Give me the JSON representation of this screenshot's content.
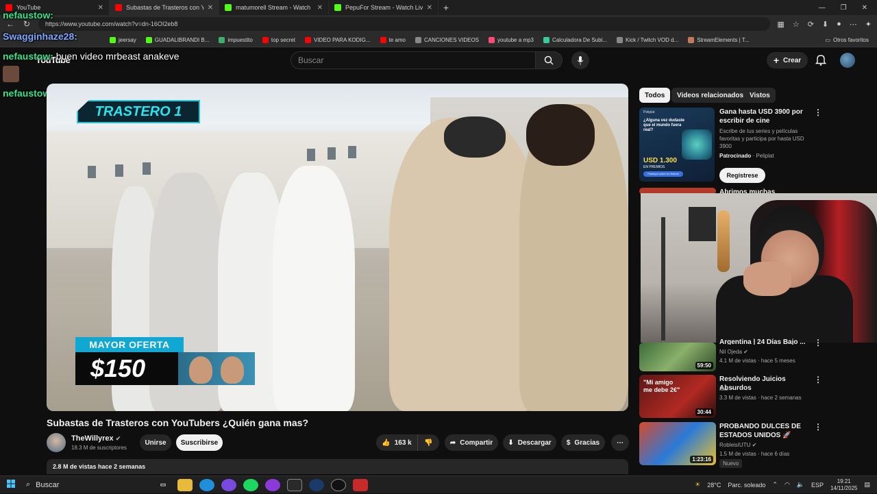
{
  "browser": {
    "tabs": [
      {
        "label": "YouTube",
        "color": "#ff0000",
        "active": false
      },
      {
        "label": "Subastas de Trasteros con Yo",
        "color": "#ff0000",
        "active": true
      },
      {
        "label": "matumorell Stream - Watch",
        "color": "#53fc18",
        "active": false
      },
      {
        "label": "PepuFor Stream - Watch Live",
        "color": "#53fc18",
        "active": false
      }
    ],
    "url": "https://www.youtube.com/watch?v=dn-16OI2eb8",
    "bookmarks": [
      {
        "label": "jeersay",
        "color": "#53fc18"
      },
      {
        "label": "GUADALIBRANDI B...",
        "color": "#53fc18"
      },
      {
        "label": "impuestito",
        "color": "#3fae6a"
      },
      {
        "label": "top secret",
        "color": "#ff0000"
      },
      {
        "label": "VIDEO PARA KODIG...",
        "color": "#ff0000"
      },
      {
        "label": "te amo",
        "color": "#ff0000"
      },
      {
        "label": "CANCIONES VIDEOS",
        "color": "#888888"
      },
      {
        "label": "youtube a mp3",
        "color": "#ff4a7a"
      },
      {
        "label": "Calculadora De Subi...",
        "color": "#39c8a0"
      },
      {
        "label": "Kick / Twitch VOD d...",
        "color": "#888888"
      },
      {
        "label": "StreamElements | T...",
        "color": "#c27a5a"
      }
    ],
    "other_bookmarks": "Otros favoritos"
  },
  "chat": [
    {
      "user": "nefaustow:",
      "message": ""
    },
    {
      "user": "Swagginhaze28:",
      "message": ""
    },
    {
      "user": "nefaustow:",
      "message": "buen video mrbeast anakeve"
    },
    {
      "user": "nefaustow:",
      "message": ""
    }
  ],
  "header": {
    "logo": "YouTube",
    "search_placeholder": "Buscar",
    "create_label": "Crear"
  },
  "video": {
    "overlay_label": "TRASTERO 1",
    "offer_label": "MAYOR OFERTA",
    "offer_value": "$150",
    "title": "Subastas de Trasteros con YouTubers ¿Quién gana mas?",
    "channel": "TheWillyrex",
    "subscribers": "18.3 M de suscriptores",
    "join_label": "Unirse",
    "subscribe_label": "Suscribirse",
    "likes": "163 k",
    "share_label": "Compartir",
    "download_label": "Descargar",
    "thanks_label": "Gracias",
    "views_line": "2.8 M de vistas  hace 2 semanas"
  },
  "sidebar": {
    "chips": [
      "Todos",
      "Videos relacionados",
      "Vistos"
    ],
    "ad": {
      "title": "Gana hasta USD 3900 por escribir de cine",
      "description": "Escribe de tus series y películas favoritas y participa por hasta USD 3900",
      "sponsored": "Patrocinado",
      "advertiser": "Peliplat",
      "cta": "Regístrese",
      "thumb_brand": "Peliplat",
      "thumb_question": "¿Alguna vez dudaste que el mundo fuera real?",
      "thumb_prize": "USD 1.300",
      "thumb_prize_note": "EN PREMIOS",
      "thumb_button": "Participa sobre la Historia"
    },
    "partial_title": "Abrimos muchas MYSTERY",
    "videos": [
      {
        "title": "Argentina | 24 Días Bajo ...",
        "channel": "Nil Ojeda",
        "meta": "4.1 M de vistas · hace 5 meses",
        "duration": "59:50",
        "thumb_text": ""
      },
      {
        "title": "Resolviendo Juicios Absurdos",
        "channel": "Ibai",
        "meta": "3.3 M de vistas · hace 2 semanas",
        "duration": "30:44",
        "thumb_text": "\"Mi amigo me debe 2€\""
      },
      {
        "title": "PROBANDO DULCES DE ESTADOS UNIDOS 🚀",
        "channel": "RobleisIUTU",
        "meta": "1.5 M de vistas · hace 6 días",
        "duration": "1:23:16",
        "thumb_text": "",
        "badge": "Nuevo"
      }
    ]
  },
  "taskbar": {
    "search": "Buscar",
    "temperature": "28°C",
    "weather": "Parc. soleado",
    "language": "ESP",
    "time": "19:21",
    "date": "14/11/2025"
  }
}
